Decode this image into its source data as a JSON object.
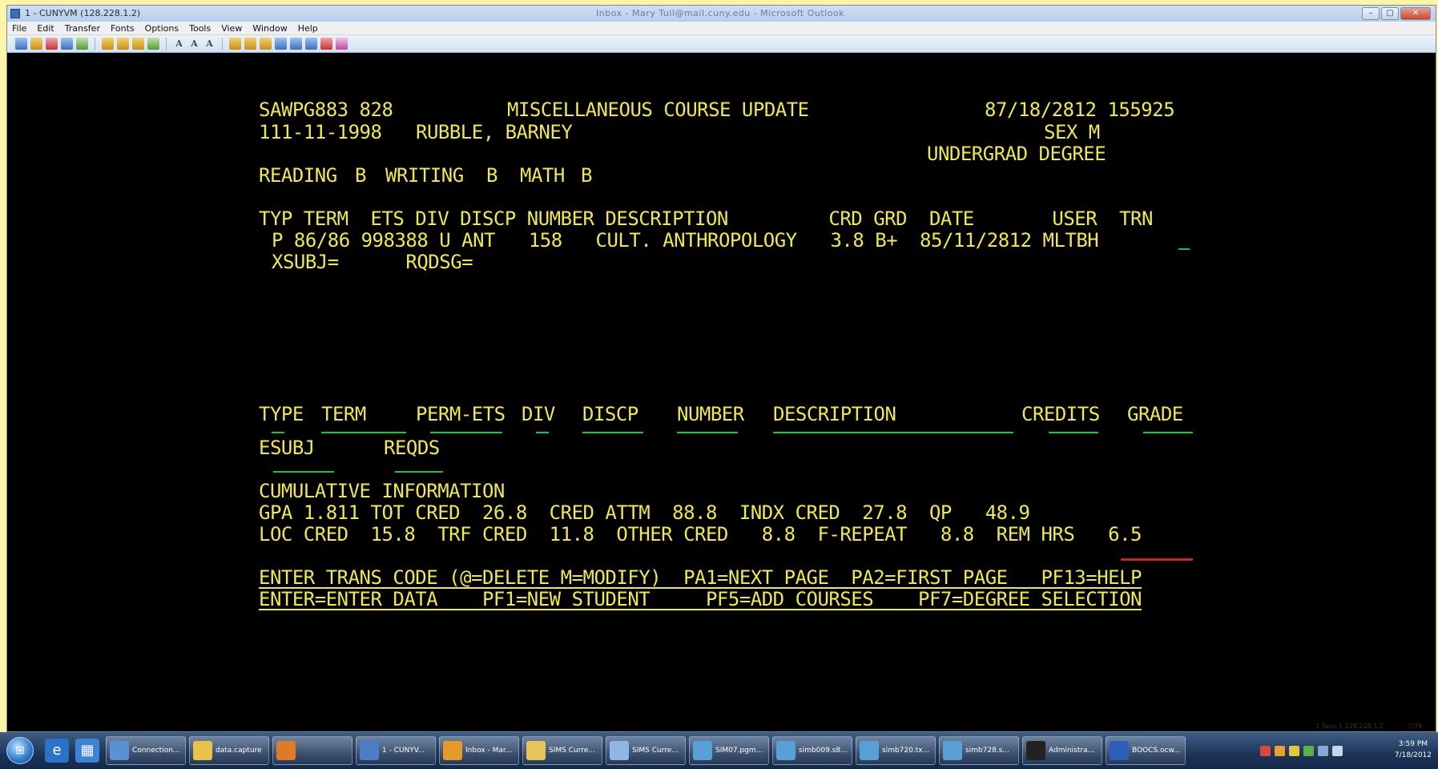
{
  "window": {
    "title": "1 - CUNYVM (128.228.1.2)",
    "center_title": "Inbox - Mary Tull@mail.cuny.edu - Microsoft Outlook",
    "buttons": [
      "–",
      "▢",
      "✕"
    ]
  },
  "menu": [
    "File",
    "Edit",
    "Transfer",
    "Fonts",
    "Options",
    "Tools",
    "View",
    "Window",
    "Help"
  ],
  "terminal": {
    "header_left": "SAWPG883 828",
    "header_title": "MISCELLANEOUS COURSE UPDATE",
    "header_date": "87/18/2812 155925",
    "student_id": "111-11-1998",
    "student_name": "RUBBLE, BARNEY",
    "sex_label": "SEX M",
    "degree": "UNDERGRAD DEGREE",
    "skills": {
      "reading_label": "READING",
      "reading_value": "B",
      "writing_label": "WRITING",
      "writing_value": "B",
      "math_label": "MATH",
      "math_value": "B"
    },
    "course_header": "TYP TERM  ETS DIV DISCP NUMBER DESCRIPTION         CRD GRD  DATE       USER  TRN",
    "course_row": "P 86/86 998388 U ANT   158   CULT. ANTHROPOLOGY   3.8 B+  85/11/2812 MLTBH",
    "course_trn": "_",
    "subj_line": "XSUBJ=      RQDSG=",
    "entry_header": {
      "type": "TYPE",
      "term": "TERM",
      "perm_ets": "PERM-ETS",
      "div": "DIV",
      "discp": "DISCP",
      "number": "NUMBER",
      "description": "DESCRIPTION",
      "credits": "CREDITS",
      "grade": "GRADE"
    },
    "esubj": "ESUBJ",
    "reqds": "REQDS",
    "cumulative_title": "CUMULATIVE INFORMATION",
    "cum_line1": "GPA 1.811 TOT CRED  26.8  CRED ATTM  88.8  INDX CRED  27.8  QP   48.9",
    "cum_line2": "LOC CRED  15.8  TRF CRED  11.8  OTHER CRED   8.8  F-REPEAT   8.8  REM HRS   6.5",
    "footer1": "ENTER TRANS CODE (@=DELETE M=MODIFY)  PA1=NEXT PAGE  PA2=FIRST PAGE   PF13=HELP",
    "footer2": "ENTER=ENTER DATA    PF1=NEW STUDENT     PF5=ADD COURSES    PF7=DEGREE SELECTION"
  },
  "status": {
    "left": "1  Sess-1  128.228.1.2",
    "right": "7/79"
  },
  "taskbar": {
    "tasks": [
      {
        "label": "Connection...",
        "color": "#5b8fd6"
      },
      {
        "label": "data.capture",
        "color": "#e9c24a"
      },
      {
        "label": "",
        "color": "#e07a2b"
      },
      {
        "label": "1 - CUNYV...",
        "color": "#4c7cc4"
      },
      {
        "label": "Inbox - Mar...",
        "color": "#e59b2c"
      },
      {
        "label": "SIMS Curre...",
        "color": "#e7c45a"
      },
      {
        "label": "SIMS Curre...",
        "color": "#8fb6e6"
      },
      {
        "label": "SIM07.pgm...",
        "color": "#5aa0d8"
      },
      {
        "label": "simb009.s8...",
        "color": "#5aa0d8"
      },
      {
        "label": "simb720.tx...",
        "color": "#5aa0d8"
      },
      {
        "label": "simb728.s...",
        "color": "#5aa0d8"
      },
      {
        "label": "Administra...",
        "color": "#222222"
      },
      {
        "label": "BOOCS.ocw...",
        "color": "#2d5fb8"
      }
    ],
    "clock_time": "3:59 PM",
    "clock_date": "7/18/2012"
  },
  "colors": {
    "terminal_text": "#f0e65a",
    "field_underline": "#19c83a",
    "screen_bg": "#000000"
  }
}
